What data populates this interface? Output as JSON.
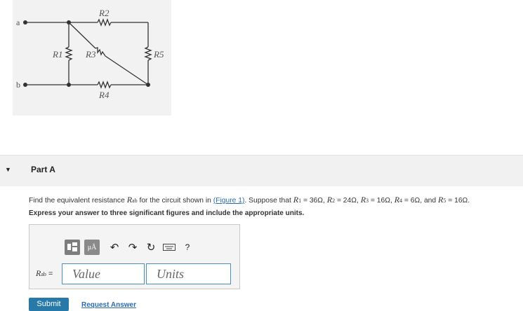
{
  "figure": {
    "node_a": "a",
    "node_b": "b",
    "resistors": [
      "R1",
      "R2",
      "R3",
      "R4",
      "R5"
    ]
  },
  "part": {
    "title": "Part A",
    "problem": {
      "intro": "Find the equivalent resistance",
      "symbol": "R",
      "symbol_sub": "ab",
      "middle": "for the circuit shown in",
      "figure_link": "(Figure 1)",
      "suppose": "Suppose that",
      "values": [
        {
          "name": "R",
          "sub": "1",
          "value": "= 36Ω,"
        },
        {
          "name": "R",
          "sub": "2",
          "value": "= 24Ω,"
        },
        {
          "name": "R",
          "sub": "3",
          "value": "= 16Ω,"
        },
        {
          "name": "R",
          "sub": "4",
          "value": "= 6Ω,"
        },
        {
          "name": "R",
          "sub": "5",
          "value": "= 16Ω."
        }
      ],
      "and_word": "and"
    },
    "instruction": "Express your answer to three significant figures and include the appropriate units.",
    "answer": {
      "label": "R",
      "label_sub": "ab",
      "equals": "=",
      "value_placeholder": "Value",
      "units_placeholder": "Units",
      "mu_button": "μÅ",
      "help": "?"
    },
    "submit_label": "Submit",
    "request_label": "Request Answer"
  }
}
